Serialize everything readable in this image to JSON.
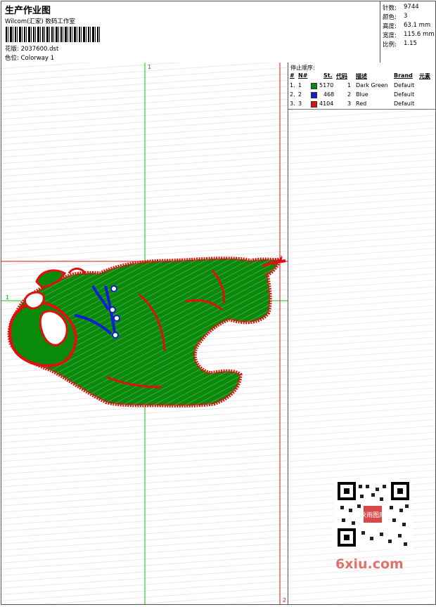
{
  "header": {
    "title": "生产作业图",
    "studio": "Wilcom(汇家) 数码工作室",
    "file_label": "花版:",
    "file_name": "2037600.dst",
    "colorway_label": "色位:",
    "colorway": "Colorway 1"
  },
  "stats": [
    {
      "label": "针数:",
      "value": "9744"
    },
    {
      "label": "颜色:",
      "value": "3"
    },
    {
      "label": "高度:",
      "value": "63.1 mm"
    },
    {
      "label": "宽度:",
      "value": "115.6 mm"
    },
    {
      "label": "比例:",
      "value": "1.15"
    }
  ],
  "markers": {
    "top": "1",
    "left": "1",
    "right_top": "2",
    "bottom": "2"
  },
  "stop_order": {
    "title": "停止顺序:",
    "headers": [
      "#",
      "N#",
      "St.",
      "代码",
      "描述",
      "Brand",
      "元素"
    ],
    "rows": [
      {
        "num": "1.",
        "n": "1",
        "color": "#0a8a0a",
        "st": "5170",
        "code": "1",
        "desc": "Dark Green",
        "brand": "Default"
      },
      {
        "num": "2.",
        "n": "2",
        "color": "#1020d0",
        "st": "468",
        "code": "2",
        "desc": "Blue",
        "brand": "Default"
      },
      {
        "num": "3.",
        "n": "3",
        "color": "#e01010",
        "st": "4104",
        "code": "3",
        "desc": "Red",
        "brand": "Default"
      }
    ]
  },
  "watermark": {
    "brand": "6xiu.com",
    "stamp": "秋雨图库"
  },
  "colors": {
    "green": "#0a8a0a",
    "blue": "#1020d0",
    "red": "#e01010",
    "guide_green": "#00cc00"
  }
}
